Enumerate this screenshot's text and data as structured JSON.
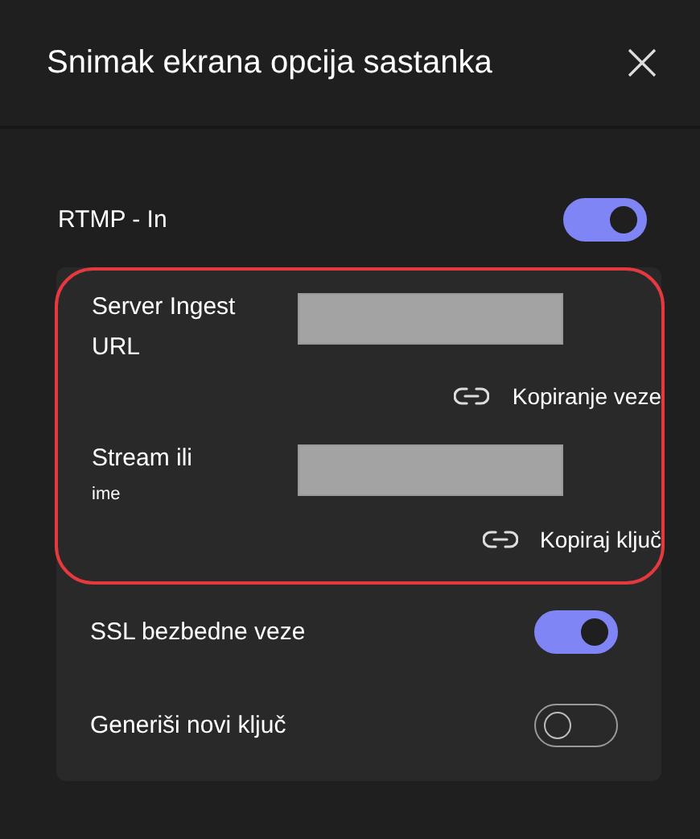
{
  "dialog": {
    "title": "Snimak ekrana opcija sastanka"
  },
  "rtmp": {
    "label": "RTMP - In",
    "on": true
  },
  "fields": [
    {
      "label_lines": [
        {
          "text": "Server Ingest",
          "small": false
        },
        {
          "text": "URL",
          "small": false
        }
      ],
      "copy_label": "Kopiranje veze"
    },
    {
      "label_lines": [
        {
          "text": "Stream ili",
          "small": false
        },
        {
          "text": "ime",
          "small": true
        }
      ],
      "copy_label": "Kopiraj ključ"
    }
  ],
  "settings": [
    {
      "label": "SSL bezbedne veze",
      "on": true
    },
    {
      "label": "Generiši novi ključ",
      "on": false
    }
  ]
}
